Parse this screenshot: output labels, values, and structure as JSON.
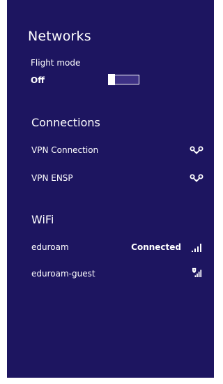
{
  "header": {
    "title": "Networks"
  },
  "flight_mode": {
    "label": "Flight mode",
    "state": "Off"
  },
  "connections": {
    "heading": "Connections",
    "items": [
      {
        "name": "VPN Connection",
        "icon": "vpn-icon"
      },
      {
        "name": "VPN ENSP",
        "icon": "vpn-icon"
      }
    ]
  },
  "wifi": {
    "heading": "WiFi",
    "items": [
      {
        "name": "eduroam",
        "status": "Connected",
        "icon": "wifi-signal-icon"
      },
      {
        "name": "eduroam-guest",
        "status": "",
        "icon": "wifi-secured-signal-icon"
      }
    ]
  },
  "colors": {
    "panel_bg": "#1d1560",
    "text": "#ffffff",
    "toggle_fill": "#3d3185"
  }
}
